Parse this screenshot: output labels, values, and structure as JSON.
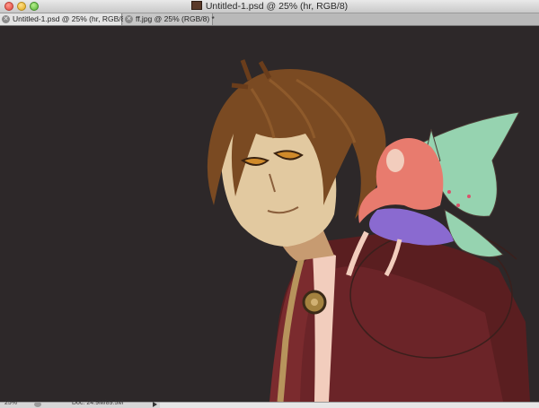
{
  "window": {
    "title": "Untitled-1.psd @ 25% (hr, RGB/8)"
  },
  "tabs": [
    {
      "label": "Untitled-1.psd @ 25% (hr, RGB/8)",
      "active": true,
      "close_icon": "close-icon"
    },
    {
      "label": "ff.jpg @ 25% (RGB/8) *",
      "active": false,
      "close_icon": "close-icon"
    }
  ],
  "statusbar": {
    "zoom": "25%",
    "doc_info": "Doc: 24.9M/89.5M"
  },
  "colors": {
    "canvas_bg": "#2d2829",
    "hair": "#7a4a22",
    "skin": "#e2c9a0",
    "cloak": "#5a1e20",
    "fairy_hair": "#e87b6e",
    "fairy_dress": "#8a6ad0",
    "wing": "#96d3b0"
  }
}
